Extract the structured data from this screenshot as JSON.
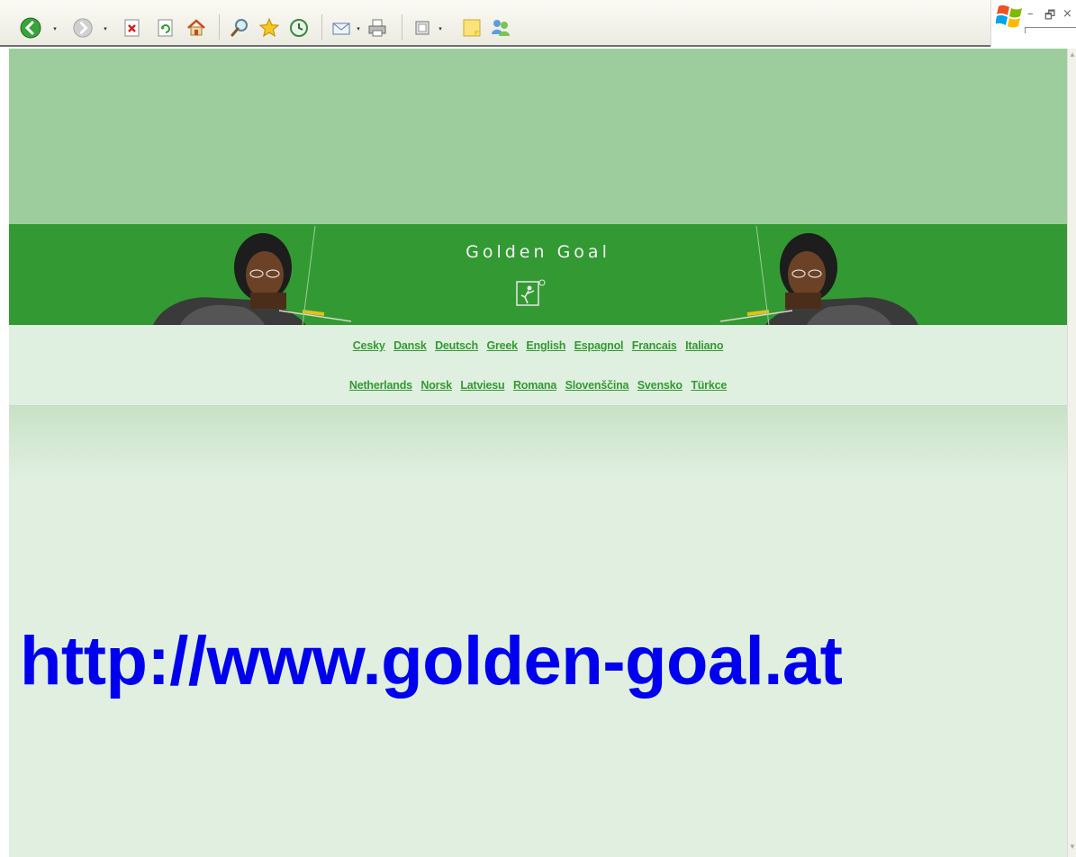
{
  "toolbar": {
    "buttons": [
      {
        "name": "back-button",
        "icon": "back-arrow-icon"
      },
      {
        "name": "forward-button",
        "icon": "forward-arrow-icon"
      },
      {
        "name": "stop-button",
        "icon": "stop-icon"
      },
      {
        "name": "refresh-button",
        "icon": "refresh-icon"
      },
      {
        "name": "home-button",
        "icon": "home-icon"
      },
      {
        "name": "search-button",
        "icon": "search-icon"
      },
      {
        "name": "favorites-button",
        "icon": "star-icon"
      },
      {
        "name": "history-button",
        "icon": "history-icon"
      },
      {
        "name": "mail-button",
        "icon": "mail-icon"
      },
      {
        "name": "print-button",
        "icon": "printer-icon"
      },
      {
        "name": "edit-button",
        "icon": "edit-icon"
      },
      {
        "name": "notes-button",
        "icon": "note-icon"
      },
      {
        "name": "messenger-button",
        "icon": "messenger-icon"
      }
    ]
  },
  "window": {
    "minimize_label": "–",
    "restore_label": "🗗",
    "close_label": "×"
  },
  "banner": {
    "title": "Golden Goal"
  },
  "languages": {
    "row1": [
      "Cesky",
      "Dansk",
      "Deutsch",
      "Greek",
      "English",
      "Espagnol",
      "Francais",
      "Italiano"
    ],
    "row2": [
      "Netherlands",
      "Norsk",
      "Latviesu",
      "Romana",
      "Slovenščina",
      "Svensko",
      "Türkce"
    ]
  },
  "content": {
    "url": "http://www.golden-goal.at"
  },
  "colors": {
    "top_band": "#9dcd9d",
    "banner": "#339933",
    "lang_band": "#e0f0e0",
    "link": "#339933",
    "url_text": "#0000ee"
  }
}
